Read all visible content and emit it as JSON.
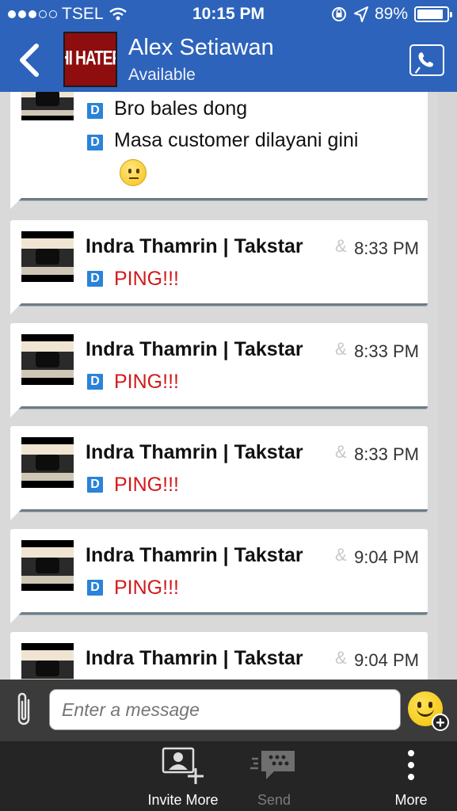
{
  "status_bar": {
    "carrier": "TSEL",
    "time": "10:15 PM",
    "battery": "89%",
    "battery_level": 0.89,
    "icons": [
      "signal-dots-icon",
      "wifi-icon",
      "rotation-lock-icon",
      "location-arrow-icon",
      "battery-icon"
    ]
  },
  "header": {
    "back_icon": "chevron-left-icon",
    "avatar_text": "HI HATER",
    "contact_name": "Alex Setiawan",
    "contact_status": "Available",
    "call_icon": "phone-icon"
  },
  "partial_message": {
    "lines": [
      "Bro bales dong",
      "Masa customer dilayani gini"
    ],
    "emoji": "neutral-face-emoji"
  },
  "messages": [
    {
      "sender": "Indra Thamrin | Takstar",
      "group_glyph": "&",
      "time": "8:33 PM",
      "text": "PING!!!"
    },
    {
      "sender": "Indra Thamrin | Takstar",
      "group_glyph": "&",
      "time": "8:33 PM",
      "text": "PING!!!"
    },
    {
      "sender": "Indra Thamrin | Takstar",
      "group_glyph": "&",
      "time": "8:33 PM",
      "text": "PING!!!"
    },
    {
      "sender": "Indra Thamrin | Takstar",
      "group_glyph": "&",
      "time": "9:04 PM",
      "text": "PING!!!"
    },
    {
      "sender": "Indra Thamrin | Takstar",
      "group_glyph": "&",
      "time": "9:04 PM",
      "text": ""
    }
  ],
  "delivered_badge": "D",
  "composer": {
    "placeholder": "Enter a message",
    "attach_icon": "paperclip-icon",
    "emoji_icon": "smiley-add-icon"
  },
  "toolbar": {
    "invite_label": "Invite More",
    "send_label": "Send",
    "more_label": "More"
  },
  "colors": {
    "header_bg": "#2d63bb",
    "ping_text": "#d21a1a",
    "delivered_badge": "#2a83d8",
    "toolbar_bg": "#252525"
  }
}
